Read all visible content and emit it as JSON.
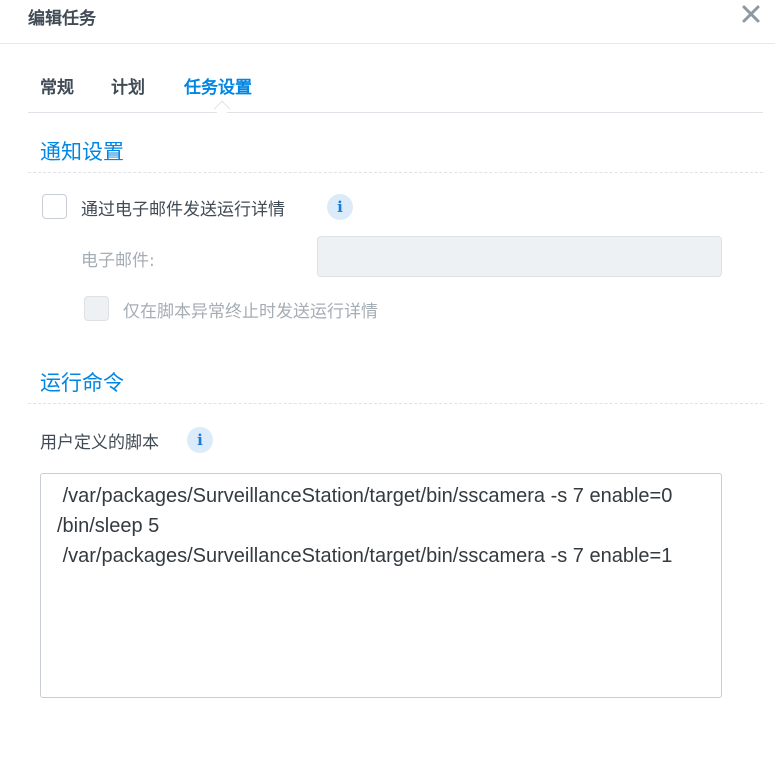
{
  "dialog": {
    "title": "编辑任务",
    "close_icon": "close-icon"
  },
  "tabs": [
    {
      "label": "常规",
      "active": false
    },
    {
      "label": "计划",
      "active": false
    },
    {
      "label": "任务设置",
      "active": true
    }
  ],
  "notification": {
    "section_title": "通知设置",
    "send_details_label": "通过电子邮件发送运行详情",
    "send_details_checked": false,
    "email_label": "电子邮件:",
    "email_value": "",
    "abnormal_only_label": "仅在脚本异常终止时发送运行详情",
    "abnormal_only_checked": false
  },
  "command": {
    "section_title": "运行命令",
    "script_label": "用户定义的脚本",
    "script_value": " /var/packages/SurveillanceStation/target/bin/sscamera -s 7 enable=0\n/bin/sleep 5\n /var/packages/SurveillanceStation/target/bin/sscamera -s 7 enable=1"
  },
  "icons": {
    "info": "i"
  },
  "colors": {
    "accent": "#0086e5",
    "text": "#414b55",
    "disabled_text": "#a5adb5"
  }
}
